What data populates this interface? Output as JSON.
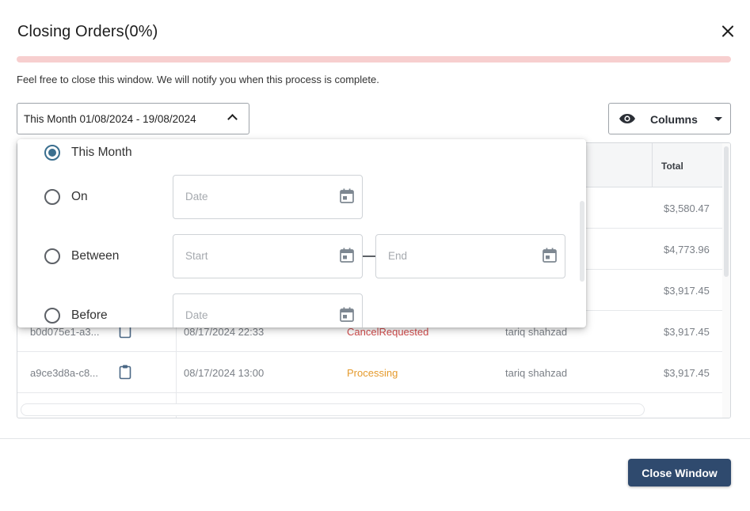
{
  "dialog": {
    "title": "Closing Orders(0%)",
    "progress_percent": 0,
    "notice": "Feel free to close this window. We will notify you when this process is complete."
  },
  "toolbar": {
    "date_filter_label": "This Month 01/08/2024 - 19/08/2024",
    "columns_label": "Columns"
  },
  "grid": {
    "header_total": "Total",
    "totals_visible_behind_dropdown": [
      "$3,580.47",
      "$4,773.96",
      "$3,917.45"
    ],
    "rows": [
      {
        "id": "b0d075e1-a3...",
        "date": "08/17/2024 22:33",
        "status": "CancelRequested",
        "user": "tariq shahzad",
        "total": "$3,917.45"
      },
      {
        "id": "a9ce3d8a-c8...",
        "date": "08/17/2024 13:00",
        "status": "Processing",
        "user": "tariq shahzad",
        "total": "$3,917.45"
      }
    ]
  },
  "date_dropdown": {
    "options": [
      {
        "label": "This Month",
        "checked": true
      },
      {
        "label": "On",
        "checked": false
      },
      {
        "label": "Between",
        "checked": false
      },
      {
        "label": "Before",
        "checked": false
      }
    ],
    "on_placeholder": "Date",
    "between_start_placeholder": "Start",
    "between_end_placeholder": "End",
    "before_placeholder": "Date"
  },
  "footer": {
    "close_window_label": "Close Window"
  },
  "colors": {
    "primary_button": "#2f4a6e",
    "radio_checked": "#3b6f8f",
    "progress_track": "#f7cfcf",
    "status_cancel": "#d04b4b",
    "status_processing": "#e59a2c"
  }
}
